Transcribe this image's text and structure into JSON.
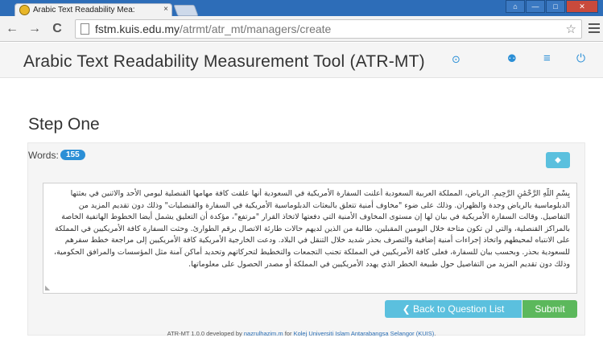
{
  "browser": {
    "tab_title": "Arabic Text Readability Mea:",
    "tab_close": "×",
    "url_host": "fstm.kuis.edu.my",
    "url_path": "/atrmt/atr_mt/managers/create",
    "back_icon": "←",
    "forward_icon": "→",
    "reload_icon": "C",
    "star_icon": "☆",
    "window_buttons": [
      "⌂",
      "—",
      "□",
      "✕"
    ]
  },
  "header": {
    "title": "Arabic Text Readability Measurement Tool (ATR-MT)",
    "icons": {
      "info": "⊙",
      "user": "⚉",
      "list": "≡",
      "power": "⏻"
    },
    "accent_color": "#2b8fd6"
  },
  "step": {
    "title": "Step One",
    "words_label": "Words:",
    "words_count": "155",
    "tag_icon": "⬥"
  },
  "text_input": {
    "value": "بِسْمِ اللَّهِ الرَّحْمَٰنِ الرَّحِيمِ. الرياض، المملكة العربية السعودية أعلنت السفارة الأمريكية في السعودية أنها علقت كافة مهامها القنصلية ليومي الأحد والاثنين في بعثتها الدبلوماسية بالرياض وجدة والظهران. وذلك على ضوء \"مخاوف أمنية تتعلق بالبعثات الدبلوماسية الأمريكية في السفارة والقنصليات\" وذلك دون تقديم المزيد من التفاصيل. وقالت السفارة الأمريكية في بيان لها إن مستوى المخاوف الأمنية التي دفعتها لاتخاذ القرار \"مرتفع\"، مؤكدة أن التعليق يشمل أيضا الخطوط الهاتفية الخاصة بالمراكز القنصلية، والتي لن تكون متاحة خلال اليومين المقبلين، طالبة من الذين لديهم حالات طارئة الاتصال برقم الطوارئ. وحثت السفارة كافة الأمريكيين في المملكة على الانتباه لمحيطهم واتخاذ إجراءات أمنية إضافية والتصرف بحذر شديد خلال التنقل في البلاد. ودعت الخارجية الأمريكية كافة الأمريكيين إلى مراجعة خطط سفرهم للسعودية بحذر. وبحسب بيان للسفارة، فعلى كافة الأمريكيين في المملكة تجنب التجمعات والتخطيط لتحركاتهم وتحديد أماكن آمنة مثل المؤسسات والمرافق الحكومية، وذلك دون تقديم المزيد من التفاصيل حول طبيعة الخطر الذي يهدد الأمريكيين في المملكة أو مصدر الحصول على معلوماتها."
  },
  "actions": {
    "back_label": "Back to Question List",
    "back_icon": "❮",
    "submit_label": "Submit",
    "back_color": "#5bc0de",
    "submit_color": "#5cb85c"
  },
  "footer": {
    "prefix": "ATR-MT 1.0.0 developed by",
    "author": "nazrulhazim.m",
    "middle": "for",
    "org": "Kolej Universiti Islam Antarabangsa Selangor (KUIS)",
    "suffix": "."
  }
}
